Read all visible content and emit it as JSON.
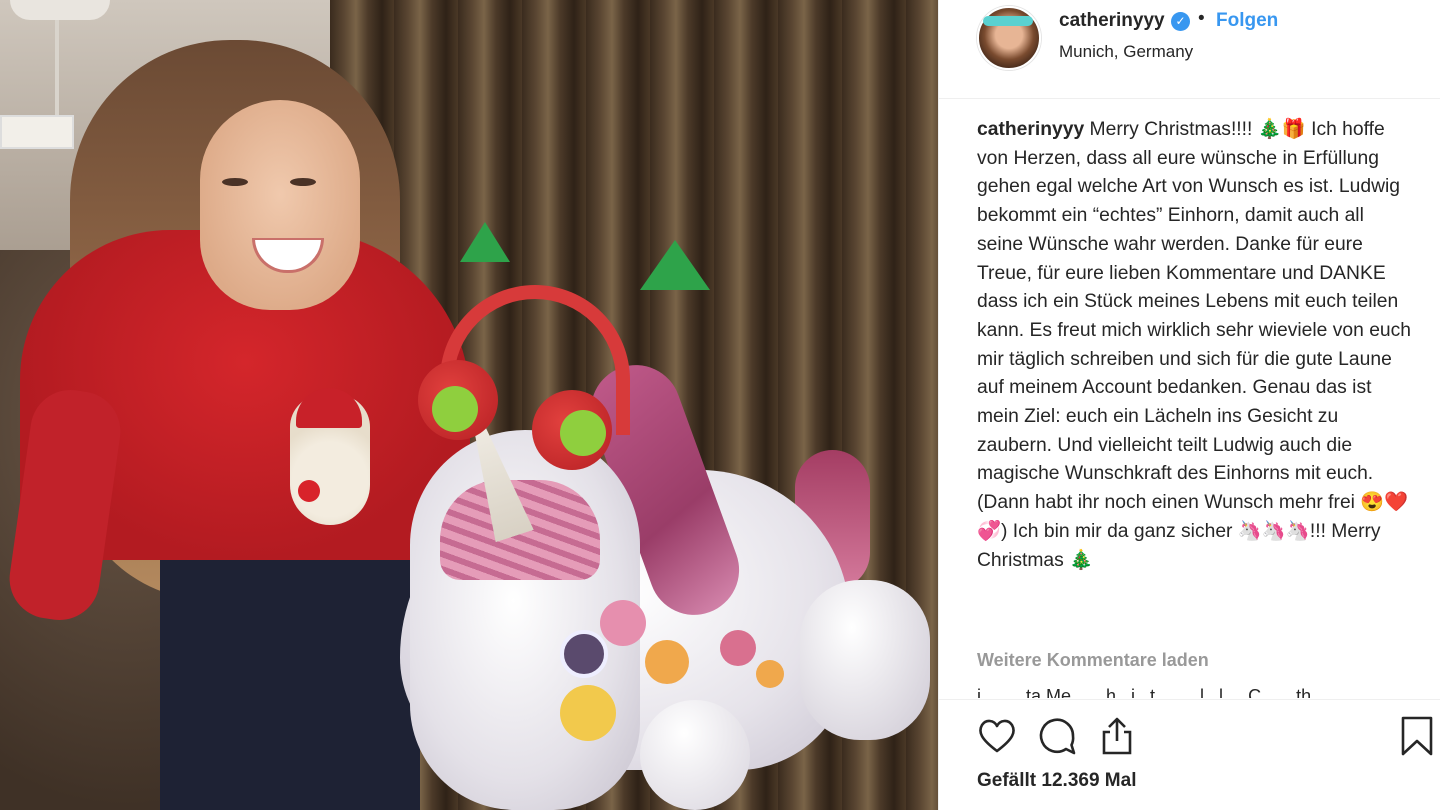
{
  "header": {
    "username": "catherinyyy",
    "verified_icon": "check-icon",
    "separator": "•",
    "follow_label": "Folgen",
    "location": "Munich, Germany"
  },
  "caption": {
    "username": "catherinyyy",
    "text": " Merry Christmas!!!! 🎄🎁 Ich hoffe von Herzen, dass all eure wünsche in Erfüllung gehen egal welche Art von Wunsch es ist. Ludwig bekommt ein “echtes” Einhorn, damit auch all seine Wünsche wahr werden. Danke für eure Treue, für eure lieben Kommentare und DANKE dass ich ein Stück meines Lebens mit euch teilen kann. Es freut mich wirklich sehr wieviele von euch mir täglich schreiben und sich für die gute Laune auf meinem Account bedanken. Genau das ist mein Ziel: euch ein Lächeln ins Gesicht zu zaubern. Und vielleicht teilt Ludwig auch die magische Wunschkraft des Einhorns mit euch. (Dann habt ihr noch einen Wunsch mehr frei 😍❤️💞) Ich bin mir da ganz sicher 🦄🦄🦄!!! Merry Christmas 🎄"
  },
  "comments": {
    "load_more_label": "Weitere Kommentare laden",
    "partial_comment": "i . . . . ta  Me . . . h . i . t . . . . l . l . . C . . . th"
  },
  "actions": {
    "like_icon": "heart-icon",
    "comment_icon": "comment-icon",
    "share_icon": "share-icon",
    "save_icon": "bookmark-icon",
    "likes_text": "Gefällt 12.369 Mal"
  },
  "colors": {
    "accent_blue": "#3897f0",
    "text": "#262626",
    "muted": "#999999",
    "border": "#efefef"
  }
}
